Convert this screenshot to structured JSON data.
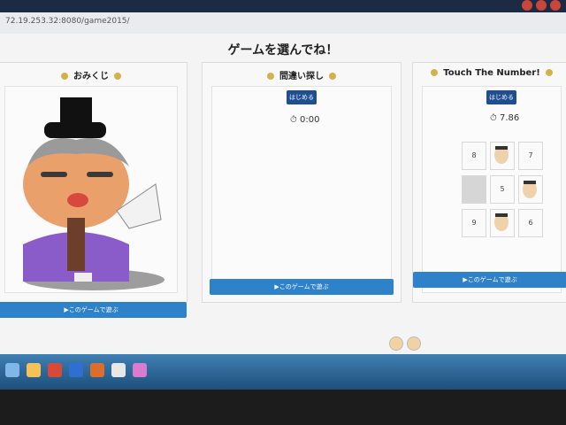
{
  "browser": {
    "address": "72.19.253.32:8080/game2015/"
  },
  "page": {
    "title": "ゲームを選んでね！"
  },
  "panels": [
    {
      "title": "おみくじ",
      "play_label": "▶このゲームで遊ぶ"
    },
    {
      "title": "間違い探し",
      "start_label": "はじめる",
      "timer": "0:00",
      "play_label": "▶このゲームで遊ぶ"
    },
    {
      "title": "Touch The Number!",
      "start_label": "はじめる",
      "timer": "7.86",
      "numbers": [
        "8",
        "",
        "7",
        "",
        "5",
        "",
        "9",
        "",
        "6"
      ],
      "play_label": "▶このゲームで遊ぶ"
    }
  ],
  "colors": {
    "button_dark": "#1f4f8f",
    "button_blue": "#2e82c9",
    "taskbar": "#2b6ea4"
  }
}
